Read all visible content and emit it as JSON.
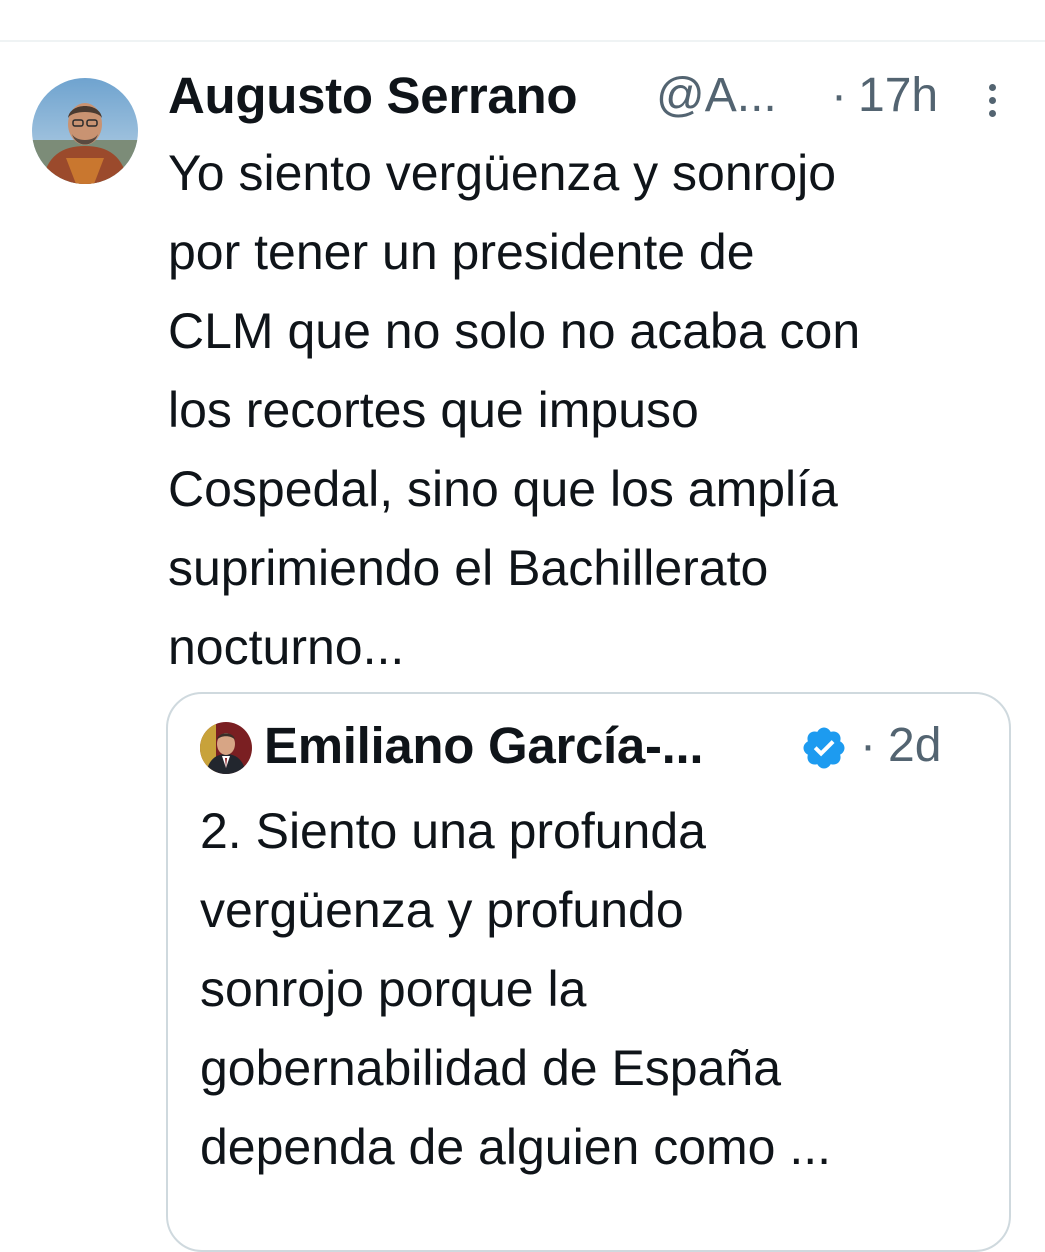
{
  "tweet": {
    "author_name": "Augusto Serrano",
    "author_handle": "@A...",
    "separator": "·",
    "time": "17h",
    "more_icon": "more-vertical-icon",
    "avatar_icon": "user-avatar-photo",
    "text_lines": [
      "Yo siento vergüenza y sonrojo",
      "por tener un presidente de",
      "CLM que no solo no acaba con",
      "los recortes que impuso",
      "Cospedal, sino que los amplía",
      "suprimiendo el Bachillerato",
      "nocturno..."
    ]
  },
  "quoted_tweet": {
    "author_name": "Emiliano García-...",
    "verified_icon": "verified-badge-icon",
    "verified_color": "#1d9bf0",
    "separator": "·",
    "time": "2d",
    "text_lines": [
      "2. Siento una profunda",
      "vergüenza y profundo",
      "sonrojo porque la",
      "gobernabilidad de España",
      "dependa de alguien como ..."
    ]
  },
  "colors": {
    "text_primary": "#0f1419",
    "text_secondary": "#536471",
    "border": "#cfd9de",
    "divider": "#eff3f4"
  }
}
